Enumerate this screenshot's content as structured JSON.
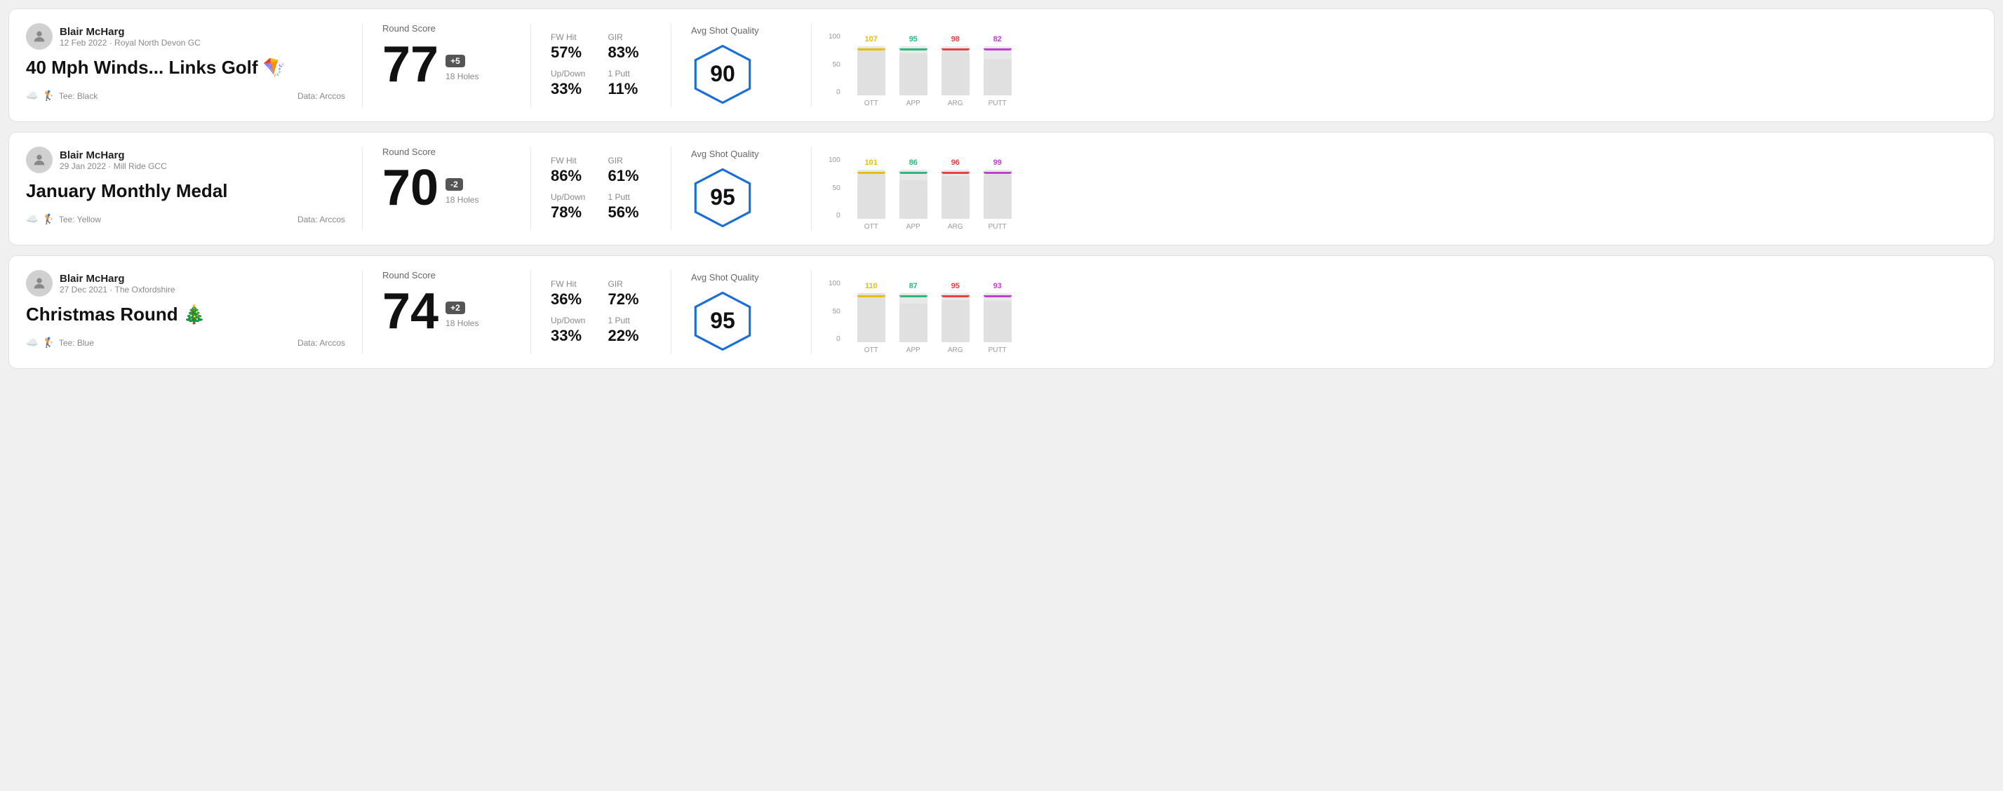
{
  "rounds": [
    {
      "id": "round-1",
      "user": {
        "name": "Blair McHarg",
        "date": "12 Feb 2022 · Royal North Devon GC"
      },
      "title": "40 Mph Winds... Links Golf",
      "title_emoji": "🪁",
      "tee": "Black",
      "data_source": "Data: Arccos",
      "score": "77",
      "score_diff": "+5",
      "holes": "18 Holes",
      "fw_hit": "57%",
      "gir": "83%",
      "up_down": "33%",
      "one_putt": "11%",
      "avg_quality": "90",
      "chart": {
        "bars": [
          {
            "label": "OTT",
            "value": 107,
            "max": 100,
            "color": "#e8c000"
          },
          {
            "label": "APP",
            "value": 95,
            "max": 100,
            "color": "#2db87e"
          },
          {
            "label": "ARG",
            "value": 98,
            "max": 100,
            "color": "#e84040"
          },
          {
            "label": "PUTT",
            "value": 82,
            "max": 100,
            "color": "#c040d0"
          }
        ]
      }
    },
    {
      "id": "round-2",
      "user": {
        "name": "Blair McHarg",
        "date": "29 Jan 2022 · Mill Ride GCC"
      },
      "title": "January Monthly Medal",
      "title_emoji": "",
      "tee": "Yellow",
      "data_source": "Data: Arccos",
      "score": "70",
      "score_diff": "-2",
      "holes": "18 Holes",
      "fw_hit": "86%",
      "gir": "61%",
      "up_down": "78%",
      "one_putt": "56%",
      "avg_quality": "95",
      "chart": {
        "bars": [
          {
            "label": "OTT",
            "value": 101,
            "max": 100,
            "color": "#e8c000"
          },
          {
            "label": "APP",
            "value": 86,
            "max": 100,
            "color": "#2db87e"
          },
          {
            "label": "ARG",
            "value": 96,
            "max": 100,
            "color": "#e84040"
          },
          {
            "label": "PUTT",
            "value": 99,
            "max": 100,
            "color": "#c040d0"
          }
        ]
      }
    },
    {
      "id": "round-3",
      "user": {
        "name": "Blair McHarg",
        "date": "27 Dec 2021 · The Oxfordshire"
      },
      "title": "Christmas Round",
      "title_emoji": "🎄",
      "tee": "Blue",
      "data_source": "Data: Arccos",
      "score": "74",
      "score_diff": "+2",
      "holes": "18 Holes",
      "fw_hit": "36%",
      "gir": "72%",
      "up_down": "33%",
      "one_putt": "22%",
      "avg_quality": "95",
      "chart": {
        "bars": [
          {
            "label": "OTT",
            "value": 110,
            "max": 100,
            "color": "#e8c000"
          },
          {
            "label": "APP",
            "value": 87,
            "max": 100,
            "color": "#2db87e"
          },
          {
            "label": "ARG",
            "value": 95,
            "max": 100,
            "color": "#e84040"
          },
          {
            "label": "PUTT",
            "value": 93,
            "max": 100,
            "color": "#c040d0"
          }
        ]
      }
    }
  ],
  "labels": {
    "round_score": "Round Score",
    "fw_hit": "FW Hit",
    "gir": "GIR",
    "up_down": "Up/Down",
    "one_putt": "1 Putt",
    "avg_quality": "Avg Shot Quality",
    "tee_prefix": "Tee: "
  }
}
